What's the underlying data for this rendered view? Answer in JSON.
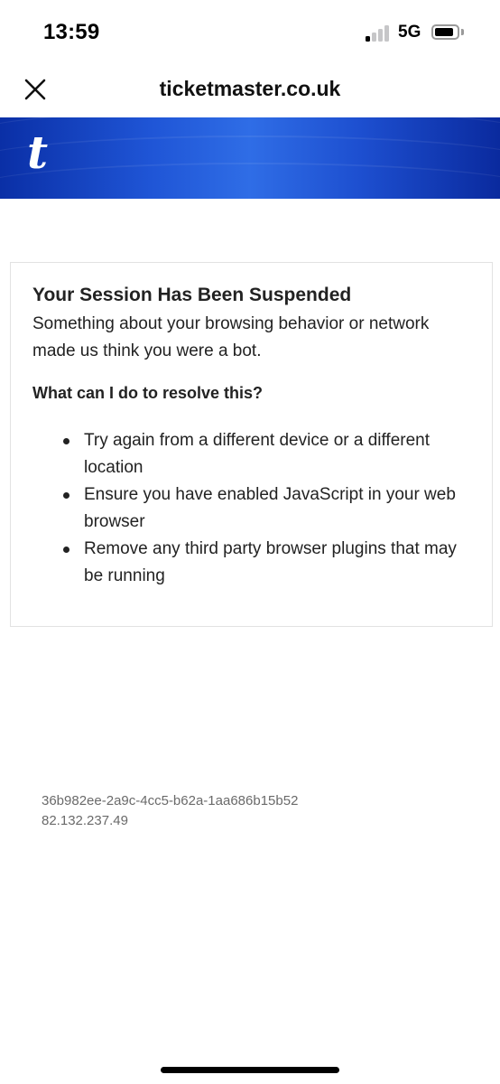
{
  "status_bar": {
    "time": "13:59",
    "network": "5G",
    "signal_bars_active": 1,
    "signal_bars_total": 4,
    "battery_level": 0.85
  },
  "browser": {
    "host": "ticketmaster.co.uk",
    "close_icon": "close-icon"
  },
  "brand": {
    "logo_text": "t",
    "banner_color": "#1f55d6"
  },
  "notice": {
    "title": "Your Session Has Been Suspended",
    "description": "Something about your browsing behavior or network made us think you were a bot.",
    "subheading": "What can I do to resolve this?",
    "items": [
      "Try again from a different device or a different location",
      "Ensure you have enabled JavaScript in your web browser",
      "Remove any third party browser plugins that may be running"
    ]
  },
  "reference": {
    "session_id": "36b982ee-2a9c-4cc5-b62a-1aa686b15b52",
    "ip_address": "82.132.237.49"
  }
}
